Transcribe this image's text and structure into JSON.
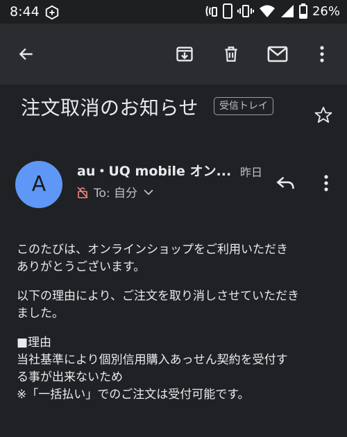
{
  "status_bar": {
    "time": "8:44",
    "battery": "26%"
  },
  "app_bar": {
    "icons": [
      "arrow-back-icon",
      "archive-icon",
      "delete-icon",
      "mail-icon",
      "more-vert-icon"
    ]
  },
  "email": {
    "subject": "注文取消のお知らせ",
    "label": "受信トレイ",
    "sender": {
      "avatar_letter": "A",
      "name": "au・UQ mobile オン...",
      "date": "昨日",
      "recipient": "To: 自分"
    },
    "body": {
      "para1_line1": "このたびは、オンラインショップをご利用いただき",
      "para1_line2": "ありがとうございます。",
      "para2_line1": "以下の理由により、ご注文を取り消しさせていただき",
      "para2_line2": "ました。",
      "reason_heading": "■理由",
      "reason_line1": "当社基準により個別信用購入あっせん契約を受付す",
      "reason_line2": "る事が出来ないため",
      "note": "※「一括払い」でのご注文は受付可能です。"
    }
  },
  "colors": {
    "background": "#202124",
    "appbar": "#2b2c2f",
    "avatar": "#5e97f6",
    "lock_icon": "#f28b82"
  }
}
